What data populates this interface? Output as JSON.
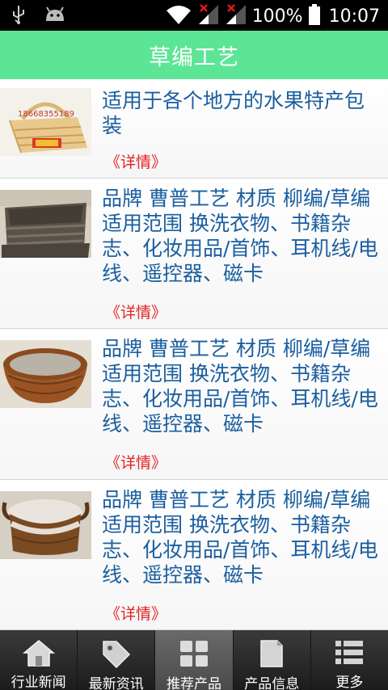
{
  "status_bar": {
    "battery": "100%",
    "time": "10:07",
    "icons": [
      "usb-icon",
      "android-icon",
      "wifi-icon",
      "signal-icon",
      "signal-icon",
      "battery-icon"
    ]
  },
  "header": {
    "title": "草编工艺"
  },
  "items": [
    {
      "title": "适用于各个地方的水果特产包装",
      "detail": "《详情》",
      "image": "fruit-basket-thumbnail"
    },
    {
      "title": "品牌 曹普工艺 材质 柳编/草编 适用范围 换洗衣物、书籍杂志、化妆用品/首饰、耳机线/电线、遥控器、磁卡",
      "detail": "《详情》",
      "image": "storage-basket-thumbnail"
    },
    {
      "title": "品牌 曹普工艺 材质 柳编/草编 适用范围 换洗衣物、书籍杂志、化妆用品/首饰、耳机线/电线、遥控器、磁卡",
      "detail": "《详情》",
      "image": "round-basket-thumbnail"
    },
    {
      "title": "品牌 曹普工艺 材质 柳编/草编 适用范围 换洗衣物、书籍杂志、化妆用品/首饰、耳机线/电线、遥控器、磁卡",
      "detail": "《详情》",
      "image": "lined-basket-thumbnail"
    }
  ],
  "thumb_caption": "18668355189",
  "bottom_nav": [
    {
      "label": "行业新闻",
      "icon": "home-icon",
      "active": false
    },
    {
      "label": "最新资讯",
      "icon": "tag-icon",
      "active": false
    },
    {
      "label": "推荐产品",
      "icon": "grid-icon",
      "active": true
    },
    {
      "label": "产品信息",
      "icon": "document-icon",
      "active": false
    },
    {
      "label": "更多",
      "icon": "list-icon",
      "active": false
    }
  ]
}
